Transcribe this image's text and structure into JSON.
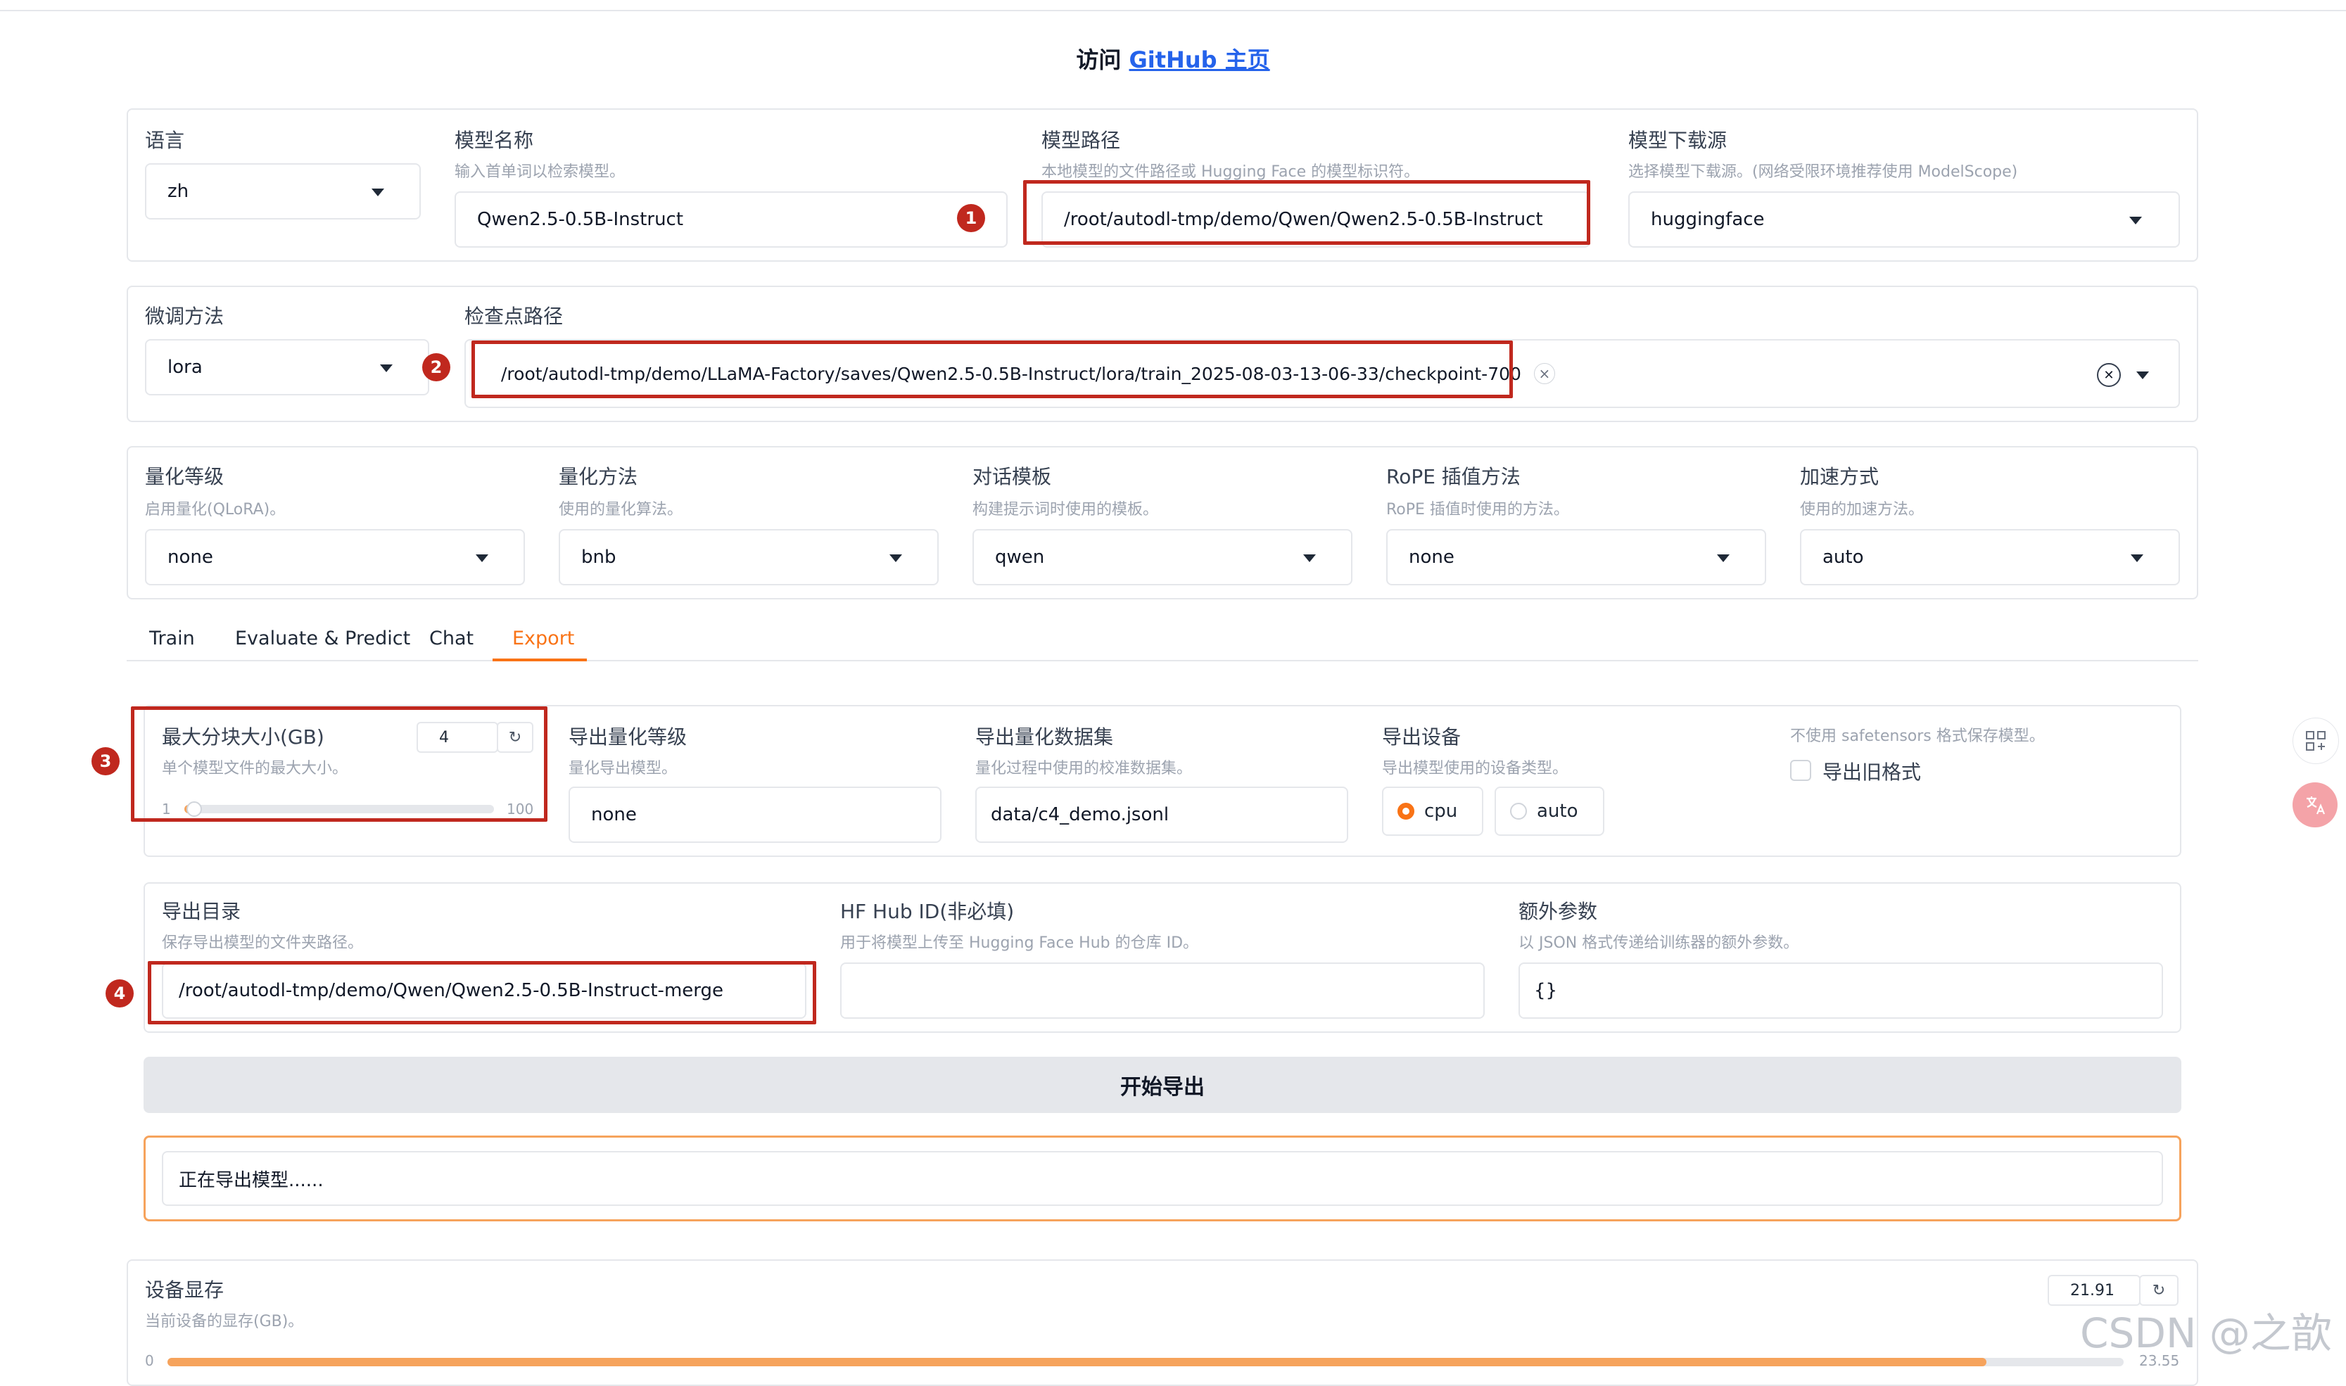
{
  "header": {
    "prefix": "访问",
    "link_text": "GitHub 主页"
  },
  "model_row": {
    "language": {
      "label": "语言",
      "value": "zh"
    },
    "model_name": {
      "label": "模型名称",
      "info": "输入首单词以检索模型。",
      "value": "Qwen2.5-0.5B-Instruct"
    },
    "model_path": {
      "label": "模型路径",
      "info": "本地模型的文件路径或 Hugging Face 的模型标识符。",
      "value": "/root/autodl-tmp/demo/Qwen/Qwen2.5-0.5B-Instruct"
    },
    "hub": {
      "label": "模型下载源",
      "info": "选择模型下载源。(网络受限环境推荐使用 ModelScope)",
      "value": "huggingface"
    }
  },
  "finetune_row": {
    "method": {
      "label": "微调方法",
      "value": "lora"
    },
    "checkpoint": {
      "label": "检查点路径",
      "value": "/root/autodl-tmp/demo/LLaMA-Factory/saves/Qwen2.5-0.5B-Instruct/lora/train_2025-08-03-13-06-33/checkpoint-700",
      "remove": "×",
      "clear": "✕"
    }
  },
  "advanced_row": {
    "quant_bit": {
      "label": "量化等级",
      "info": "启用量化(QLoRA)。",
      "value": "none"
    },
    "quant_method": {
      "label": "量化方法",
      "info": "使用的量化算法。",
      "value": "bnb"
    },
    "template": {
      "label": "对话模板",
      "info": "构建提示词时使用的模板。",
      "value": "qwen"
    },
    "rope": {
      "label": "RoPE 插值方法",
      "info": "RoPE 插值时使用的方法。",
      "value": "none"
    },
    "booster": {
      "label": "加速方式",
      "info": "使用的加速方法。",
      "value": "auto"
    }
  },
  "tabs": [
    {
      "label": "Train",
      "active": false
    },
    {
      "label": "Evaluate & Predict",
      "active": false
    },
    {
      "label": "Chat",
      "active": false
    },
    {
      "label": "Export",
      "active": true
    }
  ],
  "export": {
    "shard": {
      "label": "最大分块大小(GB)",
      "info": "单个模型文件的最大大小。",
      "value": "4",
      "min": "1",
      "max": "100",
      "fraction": 0.0303
    },
    "quant_bit": {
      "label": "导出量化等级",
      "info": "量化导出模型。",
      "value": "none"
    },
    "quant_dataset": {
      "label": "导出量化数据集",
      "info": "量化过程中使用的校准数据集。",
      "value": "data/c4_demo.jsonl"
    },
    "device": {
      "label": "导出设备",
      "info": "导出模型使用的设备类型。",
      "options": [
        "cpu",
        "auto"
      ],
      "selected": "cpu"
    },
    "legacy": {
      "info": "不使用 safetensors 格式保存模型。",
      "label": "导出旧格式",
      "checked": false
    },
    "dir": {
      "label": "导出目录",
      "info": "保存导出模型的文件夹路径。",
      "value": "/root/autodl-tmp/demo/Qwen/Qwen2.5-0.5B-Instruct-merge"
    },
    "hub_id": {
      "label": "HF Hub ID(非必填)",
      "info": "用于将模型上传至 Hugging Face Hub 的仓库 ID。",
      "value": ""
    },
    "extra": {
      "label": "额外参数",
      "info": "以 JSON 格式传递给训练器的额外参数。",
      "value": "{}"
    },
    "button": "开始导出",
    "output": "正在导出模型......"
  },
  "gpu_mem": {
    "label": "设备显存",
    "info": "当前设备的显存(GB)。",
    "value": "21.91",
    "min": "0",
    "max": "23.55",
    "fraction": 0.93
  },
  "badges": [
    "1",
    "2",
    "3",
    "4"
  ],
  "watermark": "CSDN @之歆",
  "colors": {
    "accent": "#f97316",
    "annotation": "#c0281e",
    "link": "#2563eb"
  }
}
